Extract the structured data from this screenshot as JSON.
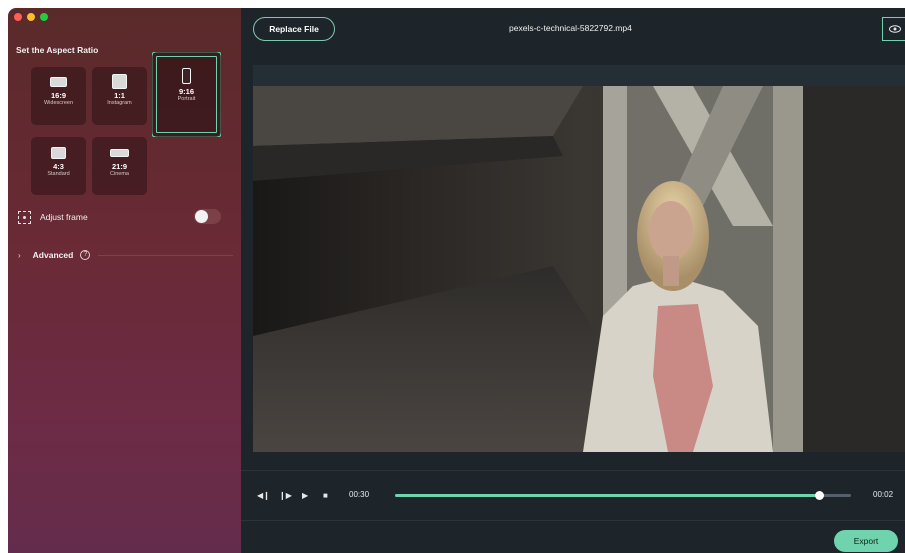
{
  "window": {
    "title_dots": [
      "close",
      "minimize",
      "zoom"
    ]
  },
  "sidebar": {
    "title": "Set the Aspect Ratio",
    "ratios": [
      {
        "ratio": "16:9",
        "name": "Widescreen"
      },
      {
        "ratio": "1:1",
        "name": "Instagram"
      },
      {
        "ratio": "9:16",
        "name": "Portrait",
        "selected": true
      },
      {
        "ratio": "4:3",
        "name": "Standard"
      },
      {
        "ratio": "21:9",
        "name": "Cinema"
      }
    ],
    "adjust_frame": {
      "label": "Adjust frame",
      "enabled": false
    },
    "advanced": {
      "label": "Advanced",
      "help": "?"
    }
  },
  "header": {
    "replace_label": "Replace File",
    "file_name": "pexels-c-technical-5822792.mp4",
    "eye_icon": "eye-icon"
  },
  "player": {
    "current_time": "00:30",
    "end_time": "00:02",
    "progress": 0.93,
    "icons": [
      "step-back-icon",
      "step-forward-icon",
      "play-icon",
      "stop-icon"
    ]
  },
  "footer": {
    "export_label": "Export"
  },
  "colors": {
    "accent": "#6fd4ad",
    "panel_left": "#6a2a36",
    "panel_right": "#1d252a"
  }
}
